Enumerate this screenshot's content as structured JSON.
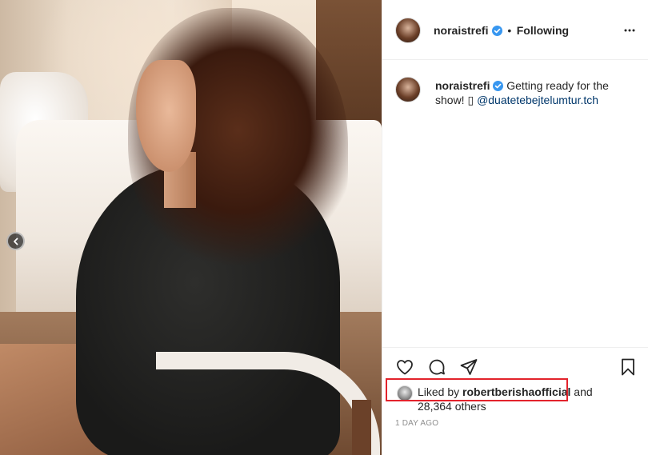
{
  "post": {
    "photo_description_icon": "post-photo",
    "carousel_prev_icon": "chevron-left-icon"
  },
  "header": {
    "username": "noraistrefi",
    "separator": "•",
    "follow_status": "Following",
    "more_icon": "more-horizontal-icon"
  },
  "caption": {
    "username": "noraistrefi",
    "text": " Getting ready for the show! ▯ ",
    "mention": "@duatetebejtelumtur.tch"
  },
  "actions": {
    "like_icon": "heart-icon",
    "comment_icon": "comment-icon",
    "share_icon": "share-icon",
    "save_icon": "bookmark-icon"
  },
  "likes": {
    "prefix": "Liked by ",
    "liker": "robertberishaofficial",
    "suffix": " and",
    "others": "28,364 others"
  },
  "timestamp": "1 day ago",
  "colors": {
    "verified": "#3897f0",
    "mention": "#00376b",
    "highlight": "#e3232c"
  }
}
